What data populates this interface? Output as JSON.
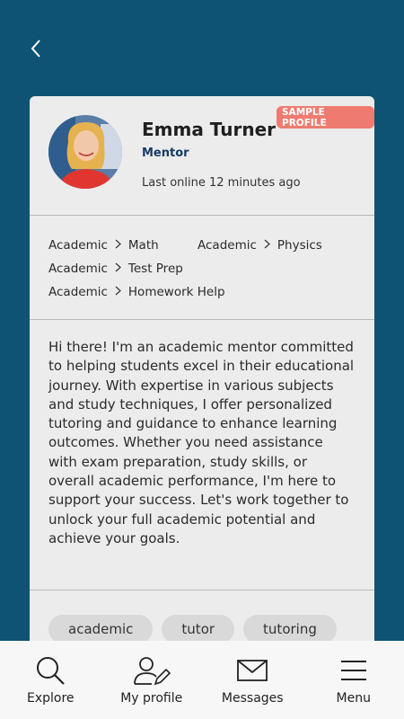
{
  "profile": {
    "name": "Emma Turner",
    "role": "Mentor",
    "last_online": "Last online 12 minutes ago",
    "badge": "SAMPLE PROFILE"
  },
  "categories": [
    {
      "parent": "Academic",
      "child": "Math"
    },
    {
      "parent": "Academic",
      "child": "Physics"
    },
    {
      "parent": "Academic",
      "child": "Test Prep"
    },
    {
      "parent": "Academic",
      "child": "Homework Help"
    }
  ],
  "bio": "Hi there! I'm an academic mentor committed to helping students excel in their educational journey. With expertise in various subjects and study techniques, I offer personalized tutoring and guidance to enhance learning outcomes. Whether you need assistance with exam preparation, study skills, or overall academic performance, I'm here to support your success. Let's work together to unlock your full academic potential and achieve your goals.",
  "tags": [
    "academic",
    "tutor",
    "tutoring"
  ],
  "nav": {
    "explore": "Explore",
    "my_profile": "My profile",
    "messages": "Messages",
    "menu": "Menu"
  },
  "colors": {
    "background": "#0e5373",
    "badge": "#ef7b70",
    "role": "#143b67"
  }
}
